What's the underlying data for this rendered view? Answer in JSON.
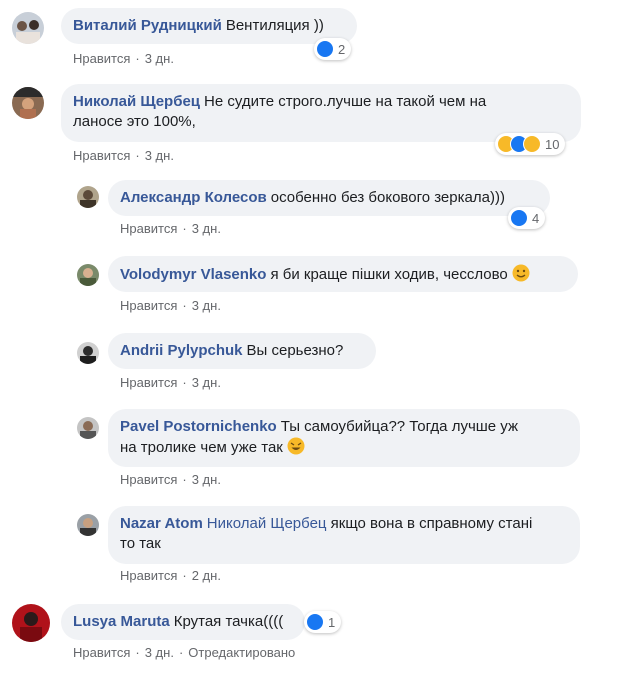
{
  "comments": [
    {
      "author": "Виталий Рудницкий",
      "text": "Вентиляция ))",
      "reply_label": "Нравится",
      "time": "3 дн.",
      "reactions_count": "2"
    },
    {
      "author": "Николай Щербец",
      "text_line1": "Не судите строго.лучше на такой чем на",
      "text_line2": "ланосе это 100%,",
      "reply_label": "Нравится",
      "time": "3 дн.",
      "reactions_count": "10"
    },
    {
      "author": "Александр Колесов",
      "text": "особенно без бокового зеркала)))",
      "reply_label": "Нравится",
      "time": "3 дн.",
      "reactions_count": "4"
    },
    {
      "author": "Volodymyr Vlasenko",
      "text": "я би краще пішки ходив, чесслово",
      "reply_label": "Нравится",
      "time": "3 дн."
    },
    {
      "author": "Andrii Pylypchuk",
      "text": "Вы серьезно?",
      "reply_label": "Нравится",
      "time": "3 дн."
    },
    {
      "author": "Pavel Postornichenko",
      "text_line1": "Ты самоубийца?? Тогда лучше уж",
      "text_line2": "на тролике чем уже так",
      "reply_label": "Нравится",
      "time": "3 дн."
    },
    {
      "author": "Nazar Atom",
      "mention": "Николай Щербец",
      "text_line1": "якщо вона в справному стані",
      "text_line2": "то так",
      "reply_label": "Нравится",
      "time": "2 дн."
    },
    {
      "author": "Lusya Maruta",
      "text": "Крутая тачка((((",
      "reply_label": "Нравится",
      "time": "3 дн.",
      "edited": "Отредактировано",
      "reactions_count": "1"
    }
  ],
  "colors": {
    "author": "#385898",
    "bubble": "#f0f2f5",
    "meta": "#65676b",
    "like": "#1877f2",
    "haha": "#f7b928"
  }
}
